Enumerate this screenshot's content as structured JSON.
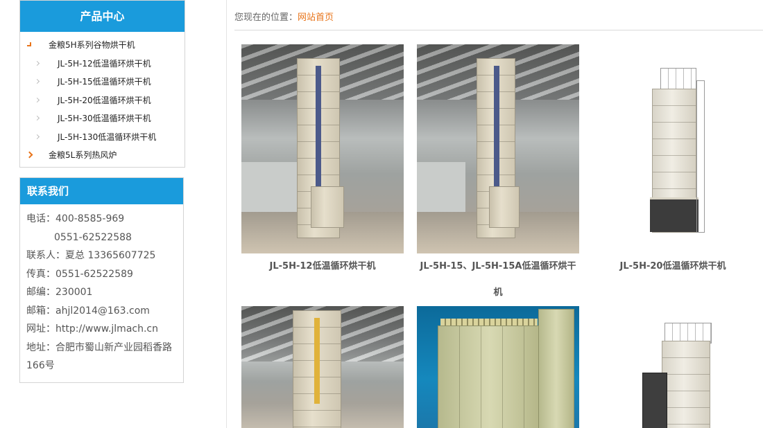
{
  "sidebar": {
    "products_title": "产品中心",
    "products": [
      {
        "label": "金粮5H系列谷物烘干机",
        "level": "top",
        "icon": "corner-arrow-icon"
      },
      {
        "label": "JL-5H-12低温循环烘干机",
        "level": "sub"
      },
      {
        "label": "JL-5H-15低温循环烘干机",
        "level": "sub"
      },
      {
        "label": "JL-5H-20低温循环烘干机",
        "level": "sub"
      },
      {
        "label": "JL-5H-30低温循环烘干机",
        "level": "sub"
      },
      {
        "label": "JL-5H-130低温循环烘干机",
        "level": "sub"
      },
      {
        "label": "金粮5L系列热风炉",
        "level": "top",
        "icon": "chevron-right-icon"
      }
    ],
    "contact_title": "联系我们",
    "contact": {
      "phone_label": "电话：",
      "phone_1": "400-8585-969",
      "phone_2": "0551-62522588",
      "person_label": "联系人：",
      "person": "夏总 13365607725",
      "fax_label": "传真：",
      "fax": "0551-62522589",
      "zip_label": "邮编：",
      "zip": "230001",
      "email_label": "邮箱：",
      "email": "ahjl2014@163.com",
      "web_label": "网址：",
      "web": "http://www.jlmach.cn",
      "addr_label": "地址：",
      "addr_1": "合肥市蜀山新产业园稻香路",
      "addr_2": "166号"
    }
  },
  "breadcrumb": {
    "prefix": "您现在的位置：",
    "home": "网站首页"
  },
  "products": [
    {
      "title": "JL-5H-12低温循环烘干机"
    },
    {
      "title_line1": "JL-5H-15、JL-5H-15A低温循环烘干",
      "title_line2": "机"
    },
    {
      "title": "JL-5H-20低温循环烘干机"
    }
  ],
  "colors": {
    "accent_blue": "#1a9bdc",
    "accent_orange": "#e8741a"
  }
}
